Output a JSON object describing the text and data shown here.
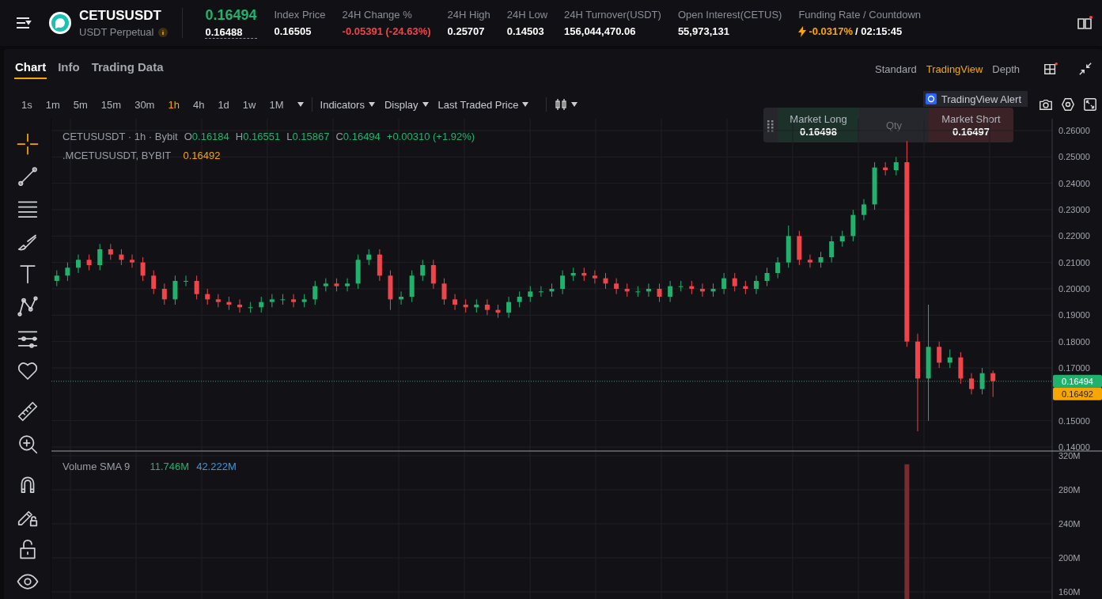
{
  "header": {
    "symbol": "CETUSUSDT",
    "contract": "USDT Perpetual",
    "last_price": "0.16494",
    "mark_price": "0.16488",
    "stats": [
      {
        "label": "Index Price",
        "value": "0.16505",
        "kind": "plain"
      },
      {
        "label": "24H Change %",
        "value": "-0.05391 (-24.63%)",
        "kind": "down"
      },
      {
        "label": "24H High",
        "value": "0.25707",
        "kind": "plain"
      },
      {
        "label": "24H Low",
        "value": "0.14503",
        "kind": "plain"
      },
      {
        "label": "24H Turnover(USDT)",
        "value": "156,044,470.06",
        "kind": "plain"
      },
      {
        "label": "Open Interest(CETUS)",
        "value": "55,973,131",
        "kind": "plain"
      },
      {
        "label": "Funding Rate / Countdown",
        "value": "-0.0317%",
        "extra": "/ 02:15:45",
        "kind": "funding"
      }
    ]
  },
  "tabs": [
    {
      "label": "Chart",
      "selected": true
    },
    {
      "label": "Info",
      "selected": false
    },
    {
      "label": "Trading Data",
      "selected": false
    }
  ],
  "views": [
    {
      "label": "Standard",
      "selected": false
    },
    {
      "label": "TradingView",
      "selected": true
    },
    {
      "label": "Depth",
      "selected": false
    }
  ],
  "intervals": [
    {
      "label": "1s",
      "selected": false
    },
    {
      "label": "1m",
      "selected": false
    },
    {
      "label": "5m",
      "selected": false
    },
    {
      "label": "15m",
      "selected": false
    },
    {
      "label": "30m",
      "selected": false
    },
    {
      "label": "1h",
      "selected": true
    },
    {
      "label": "4h",
      "selected": false
    },
    {
      "label": "1d",
      "selected": false
    },
    {
      "label": "1w",
      "selected": false
    },
    {
      "label": "1M",
      "selected": false
    }
  ],
  "menus": [
    "Indicators",
    "Display",
    "Last Traded Price"
  ],
  "alert_button": "TradingView Alert",
  "quick_trade": {
    "long_label": "Market Long",
    "long_price": "0.16498",
    "qty_placeholder": "Qty",
    "short_label": "Market Short",
    "short_price": "0.16497"
  },
  "tool_groups": [
    {
      "tools": [
        {
          "kind": "crosshair",
          "selected": true
        },
        {
          "kind": "line",
          "selected": false
        },
        {
          "kind": "hlines",
          "selected": false
        },
        {
          "kind": "brush",
          "selected": false
        },
        {
          "kind": "text",
          "selected": false
        },
        {
          "kind": "pattern",
          "selected": false
        },
        {
          "kind": "forecast",
          "selected": false
        },
        {
          "kind": "heart",
          "selected": false
        }
      ]
    },
    {
      "tools": [
        {
          "kind": "ruler",
          "selected": false
        },
        {
          "kind": "zoom",
          "selected": false
        }
      ]
    },
    {
      "tools": [
        {
          "kind": "magnet",
          "selected": false
        },
        {
          "kind": "pencil-lock",
          "selected": false
        },
        {
          "kind": "unlock",
          "selected": false
        },
        {
          "kind": "eye",
          "selected": false
        }
      ]
    }
  ],
  "legend": {
    "title": "CETUSUSDT · 1h · Bybit",
    "ohlc": [
      {
        "label": "O",
        "value": "0.16184"
      },
      {
        "label": "H",
        "value": "0.16551"
      },
      {
        "label": "L",
        "value": "0.15867"
      },
      {
        "label": "C",
        "value": "0.16494"
      }
    ],
    "change": "+0.00310 (+1.92%)",
    "mark_name": ".MCETUSUSDT, BYBIT",
    "mark_value": "0.16492"
  },
  "price_tags": [
    {
      "text": "0.16494",
      "color": "#20b26c"
    },
    {
      "text": "0.16492",
      "color": "#f7a600"
    }
  ],
  "price_chart": {
    "chart_data": {
      "type": "candlestick",
      "grid": true,
      "ylim": [
        0.14,
        0.26
      ],
      "yticks": [
        {
          "value": 0.26,
          "label": "0.26000"
        },
        {
          "value": 0.25,
          "label": "0.25000"
        },
        {
          "value": 0.24,
          "label": "0.24000"
        },
        {
          "value": 0.23,
          "label": "0.23000"
        },
        {
          "value": 0.22,
          "label": "0.22000"
        },
        {
          "value": 0.21,
          "label": "0.21000"
        },
        {
          "value": 0.2,
          "label": "0.20000"
        },
        {
          "value": 0.19,
          "label": "0.19000"
        },
        {
          "value": 0.18,
          "label": "0.18000"
        },
        {
          "value": 0.17,
          "label": "0.17000"
        },
        {
          "value": 0.15,
          "label": "0.15000"
        },
        {
          "value": 0.14,
          "label": "0.14000"
        }
      ],
      "ohlc": [
        [
          0.203,
          0.207,
          0.201,
          0.205
        ],
        [
          0.205,
          0.21,
          0.203,
          0.208
        ],
        [
          0.208,
          0.213,
          0.206,
          0.211
        ],
        [
          0.211,
          0.213,
          0.207,
          0.209
        ],
        [
          0.209,
          0.217,
          0.207,
          0.215
        ],
        [
          0.215,
          0.217,
          0.211,
          0.213
        ],
        [
          0.213,
          0.215,
          0.209,
          0.211
        ],
        [
          0.211,
          0.213,
          0.208,
          0.21
        ],
        [
          0.21,
          0.212,
          0.203,
          0.205
        ],
        [
          0.205,
          0.207,
          0.198,
          0.2
        ],
        [
          0.2,
          0.202,
          0.194,
          0.196
        ],
        [
          0.196,
          0.205,
          0.194,
          0.203
        ],
        [
          0.203,
          0.205,
          0.201,
          0.203
        ],
        [
          0.203,
          0.205,
          0.196,
          0.198
        ],
        [
          0.198,
          0.2,
          0.194,
          0.196
        ],
        [
          0.196,
          0.198,
          0.193,
          0.195
        ],
        [
          0.195,
          0.197,
          0.192,
          0.194
        ],
        [
          0.194,
          0.196,
          0.191,
          0.193
        ],
        [
          0.193,
          0.195,
          0.191,
          0.193
        ],
        [
          0.193,
          0.197,
          0.191,
          0.195
        ],
        [
          0.195,
          0.198,
          0.193,
          0.196
        ],
        [
          0.196,
          0.198,
          0.194,
          0.196
        ],
        [
          0.196,
          0.198,
          0.193,
          0.195
        ],
        [
          0.195,
          0.198,
          0.193,
          0.196
        ],
        [
          0.196,
          0.203,
          0.194,
          0.201
        ],
        [
          0.201,
          0.204,
          0.199,
          0.202
        ],
        [
          0.202,
          0.204,
          0.199,
          0.201
        ],
        [
          0.201,
          0.204,
          0.199,
          0.202
        ],
        [
          0.202,
          0.213,
          0.2,
          0.211
        ],
        [
          0.211,
          0.215,
          0.209,
          0.213
        ],
        [
          0.213,
          0.215,
          0.203,
          0.205
        ],
        [
          0.205,
          0.207,
          0.192,
          0.196
        ],
        [
          0.196,
          0.199,
          0.194,
          0.197
        ],
        [
          0.197,
          0.207,
          0.195,
          0.205
        ],
        [
          0.205,
          0.211,
          0.203,
          0.209
        ],
        [
          0.209,
          0.211,
          0.2,
          0.202
        ],
        [
          0.202,
          0.204,
          0.194,
          0.196
        ],
        [
          0.196,
          0.198,
          0.192,
          0.194
        ],
        [
          0.194,
          0.196,
          0.191,
          0.193
        ],
        [
          0.193,
          0.196,
          0.191,
          0.194
        ],
        [
          0.194,
          0.196,
          0.19,
          0.192
        ],
        [
          0.192,
          0.194,
          0.189,
          0.191
        ],
        [
          0.191,
          0.197,
          0.189,
          0.195
        ],
        [
          0.195,
          0.199,
          0.193,
          0.197
        ],
        [
          0.197,
          0.201,
          0.195,
          0.199
        ],
        [
          0.199,
          0.201,
          0.197,
          0.199
        ],
        [
          0.199,
          0.202,
          0.197,
          0.2
        ],
        [
          0.2,
          0.207,
          0.198,
          0.205
        ],
        [
          0.205,
          0.208,
          0.203,
          0.206
        ],
        [
          0.206,
          0.208,
          0.203,
          0.205
        ],
        [
          0.205,
          0.207,
          0.202,
          0.204
        ],
        [
          0.204,
          0.206,
          0.2,
          0.202
        ],
        [
          0.202,
          0.204,
          0.198,
          0.2
        ],
        [
          0.2,
          0.202,
          0.197,
          0.199
        ],
        [
          0.199,
          0.201,
          0.197,
          0.199
        ],
        [
          0.199,
          0.202,
          0.197,
          0.2
        ],
        [
          0.2,
          0.202,
          0.195,
          0.197
        ],
        [
          0.197,
          0.203,
          0.195,
          0.201
        ],
        [
          0.201,
          0.203,
          0.199,
          0.201
        ],
        [
          0.201,
          0.203,
          0.198,
          0.2
        ],
        [
          0.2,
          0.202,
          0.197,
          0.199
        ],
        [
          0.199,
          0.202,
          0.197,
          0.2
        ],
        [
          0.2,
          0.206,
          0.198,
          0.204
        ],
        [
          0.204,
          0.206,
          0.199,
          0.201
        ],
        [
          0.201,
          0.203,
          0.198,
          0.2
        ],
        [
          0.2,
          0.205,
          0.198,
          0.203
        ],
        [
          0.203,
          0.208,
          0.201,
          0.206
        ],
        [
          0.206,
          0.212,
          0.204,
          0.21
        ],
        [
          0.21,
          0.224,
          0.208,
          0.22
        ],
        [
          0.22,
          0.222,
          0.209,
          0.211
        ],
        [
          0.211,
          0.213,
          0.208,
          0.21
        ],
        [
          0.21,
          0.214,
          0.208,
          0.212
        ],
        [
          0.212,
          0.22,
          0.21,
          0.218
        ],
        [
          0.218,
          0.222,
          0.216,
          0.22
        ],
        [
          0.22,
          0.23,
          0.218,
          0.228
        ],
        [
          0.228,
          0.234,
          0.226,
          0.232
        ],
        [
          0.232,
          0.248,
          0.23,
          0.246
        ],
        [
          0.246,
          0.248,
          0.243,
          0.245
        ],
        [
          0.245,
          0.25,
          0.243,
          0.248
        ],
        [
          0.248,
          0.256,
          0.178,
          0.18
        ],
        [
          0.18,
          0.183,
          0.146,
          0.166
        ],
        [
          0.166,
          0.194,
          0.15,
          0.178
        ],
        [
          0.178,
          0.18,
          0.17,
          0.172
        ],
        [
          0.172,
          0.177,
          0.17,
          0.174
        ],
        [
          0.174,
          0.176,
          0.164,
          0.166
        ],
        [
          0.166,
          0.168,
          0.16,
          0.162
        ],
        [
          0.162,
          0.17,
          0.16,
          0.168
        ],
        [
          0.168,
          0.169,
          0.159,
          0.165
        ],
        null,
        null,
        null,
        null,
        null
      ]
    }
  },
  "volume_legend": {
    "title": "Volume SMA 9",
    "values": [
      {
        "text": "11.746M",
        "color": "#20b26c"
      },
      {
        "text": "42.222M",
        "color": "#2e9bf0"
      }
    ]
  },
  "volume_chart": {
    "chart_data": {
      "type": "bar",
      "grid": true,
      "ylim": [
        150,
        320
      ],
      "yticks": [
        {
          "value": 320,
          "label": "320M"
        },
        {
          "value": 280,
          "label": "280M"
        },
        {
          "value": 240,
          "label": "240M"
        },
        {
          "value": 200,
          "label": "200M"
        },
        {
          "value": 160,
          "label": "160M"
        }
      ],
      "values": [
        null,
        null,
        null,
        null,
        null,
        null,
        null,
        null,
        null,
        null,
        null,
        null,
        null,
        null,
        null,
        null,
        null,
        null,
        null,
        null,
        null,
        null,
        null,
        null,
        null,
        null,
        null,
        null,
        null,
        null,
        null,
        null,
        null,
        null,
        null,
        null,
        null,
        null,
        null,
        null,
        null,
        null,
        null,
        null,
        null,
        null,
        null,
        null,
        null,
        null,
        null,
        null,
        null,
        null,
        null,
        null,
        null,
        null,
        null,
        null,
        null,
        null,
        null,
        null,
        null,
        null,
        null,
        null,
        null,
        null,
        null,
        null,
        null,
        null,
        null,
        null,
        null,
        null,
        null,
        310,
        null,
        null,
        null,
        null,
        null,
        null,
        null,
        null,
        null,
        null,
        null,
        null,
        null
      ]
    }
  }
}
